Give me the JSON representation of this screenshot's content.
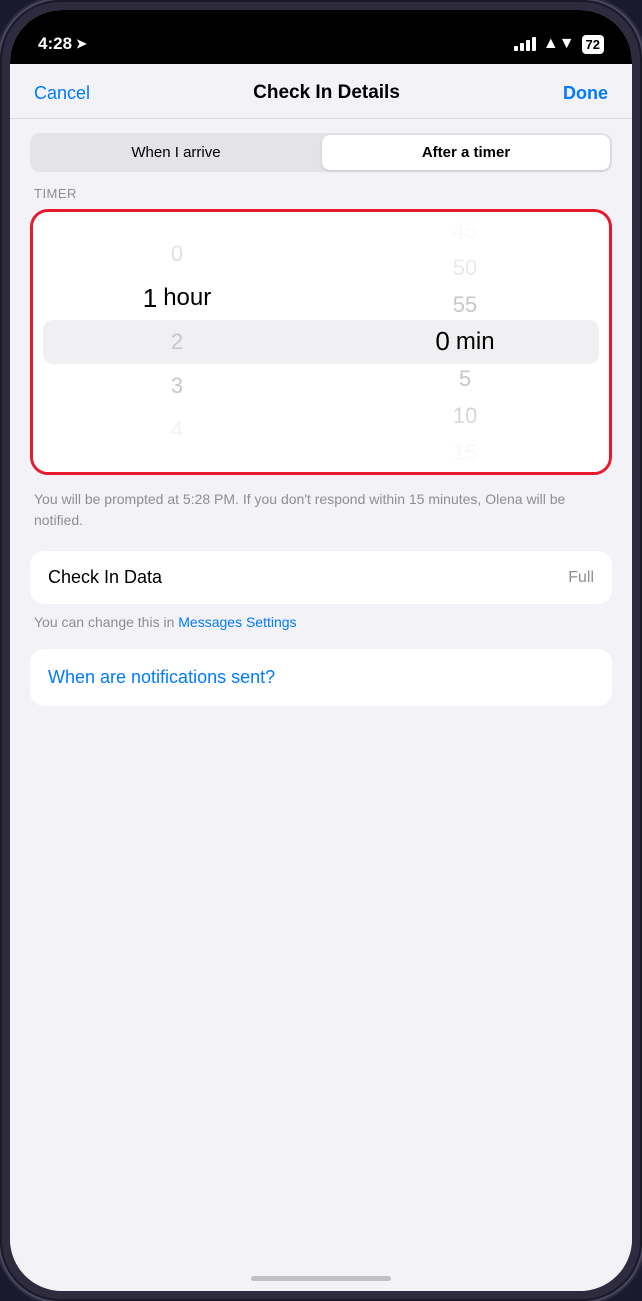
{
  "statusBar": {
    "time": "4:28",
    "battery": "72"
  },
  "navBar": {
    "cancelLabel": "Cancel",
    "title": "Check In Details",
    "doneLabel": "Done"
  },
  "segmented": {
    "option1": "When I arrive",
    "option2": "After a timer",
    "activeIndex": 1
  },
  "timer": {
    "sectionLabel": "TIMER",
    "hours": {
      "items": [
        "0",
        "1",
        "2",
        "3",
        "4"
      ],
      "selectedIndex": 1,
      "selectedValue": "1",
      "unit": "hour"
    },
    "minutes": {
      "items": [
        "50",
        "55",
        "0",
        "5",
        "10",
        "15"
      ],
      "selectedIndex": 2,
      "selectedValue": "0",
      "unit": "min"
    }
  },
  "promptText": "You will be prompted at 5:28 PM. If you don't respond within 15 minutes, Olena will be notified.",
  "checkInData": {
    "label": "Check In Data",
    "value": "Full"
  },
  "settingsHint": {
    "prefix": "You can change this in ",
    "linkText": "Messages Settings"
  },
  "notificationsBtn": "When are notifications sent?"
}
